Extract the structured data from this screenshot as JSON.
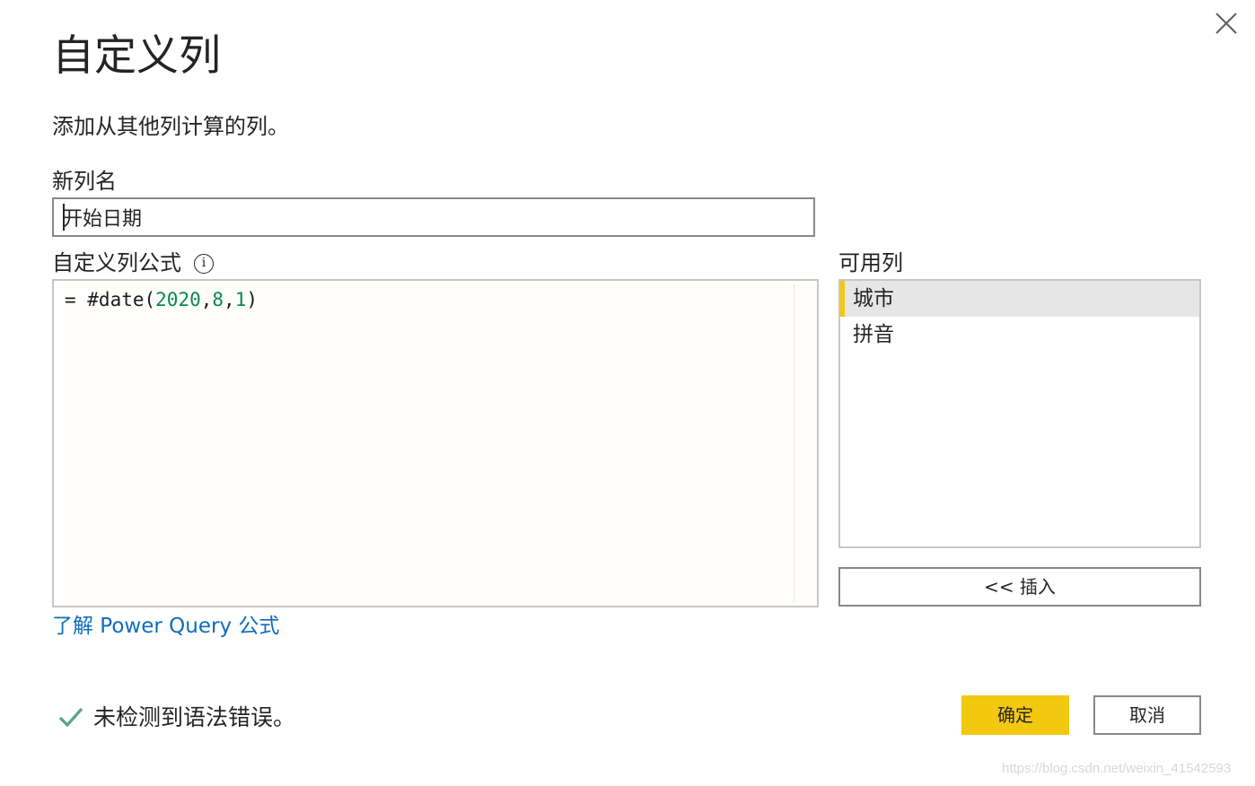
{
  "dialog": {
    "title": "自定义列",
    "subtitle": "添加从其他列计算的列。",
    "close_icon": "close-icon"
  },
  "new_column": {
    "label": "新列名",
    "value": "开始日期"
  },
  "formula": {
    "label": "自定义列公式",
    "info_icon": "info-icon",
    "info_glyph": "i",
    "tokens": {
      "prefix": "= #date(",
      "year": "2020",
      "comma1": ",",
      "month": "8",
      "comma2": ",",
      "day": "1",
      "close": ")"
    },
    "learn_link": "了解 Power Query 公式"
  },
  "available_columns": {
    "label": "可用列",
    "items": [
      {
        "label": "城市",
        "selected": true
      },
      {
        "label": "拼音",
        "selected": false
      }
    ],
    "insert_button": "<< 插入"
  },
  "status": {
    "icon": "check-icon",
    "text": "未检测到语法错误。"
  },
  "buttons": {
    "ok": "确定",
    "cancel": "取消"
  },
  "watermark": "https://blog.csdn.net/weixin_41542593",
  "colors": {
    "accent": "#f2c811",
    "link": "#0f6cbd",
    "number_token": "#098658",
    "check": "#5aa38f"
  }
}
